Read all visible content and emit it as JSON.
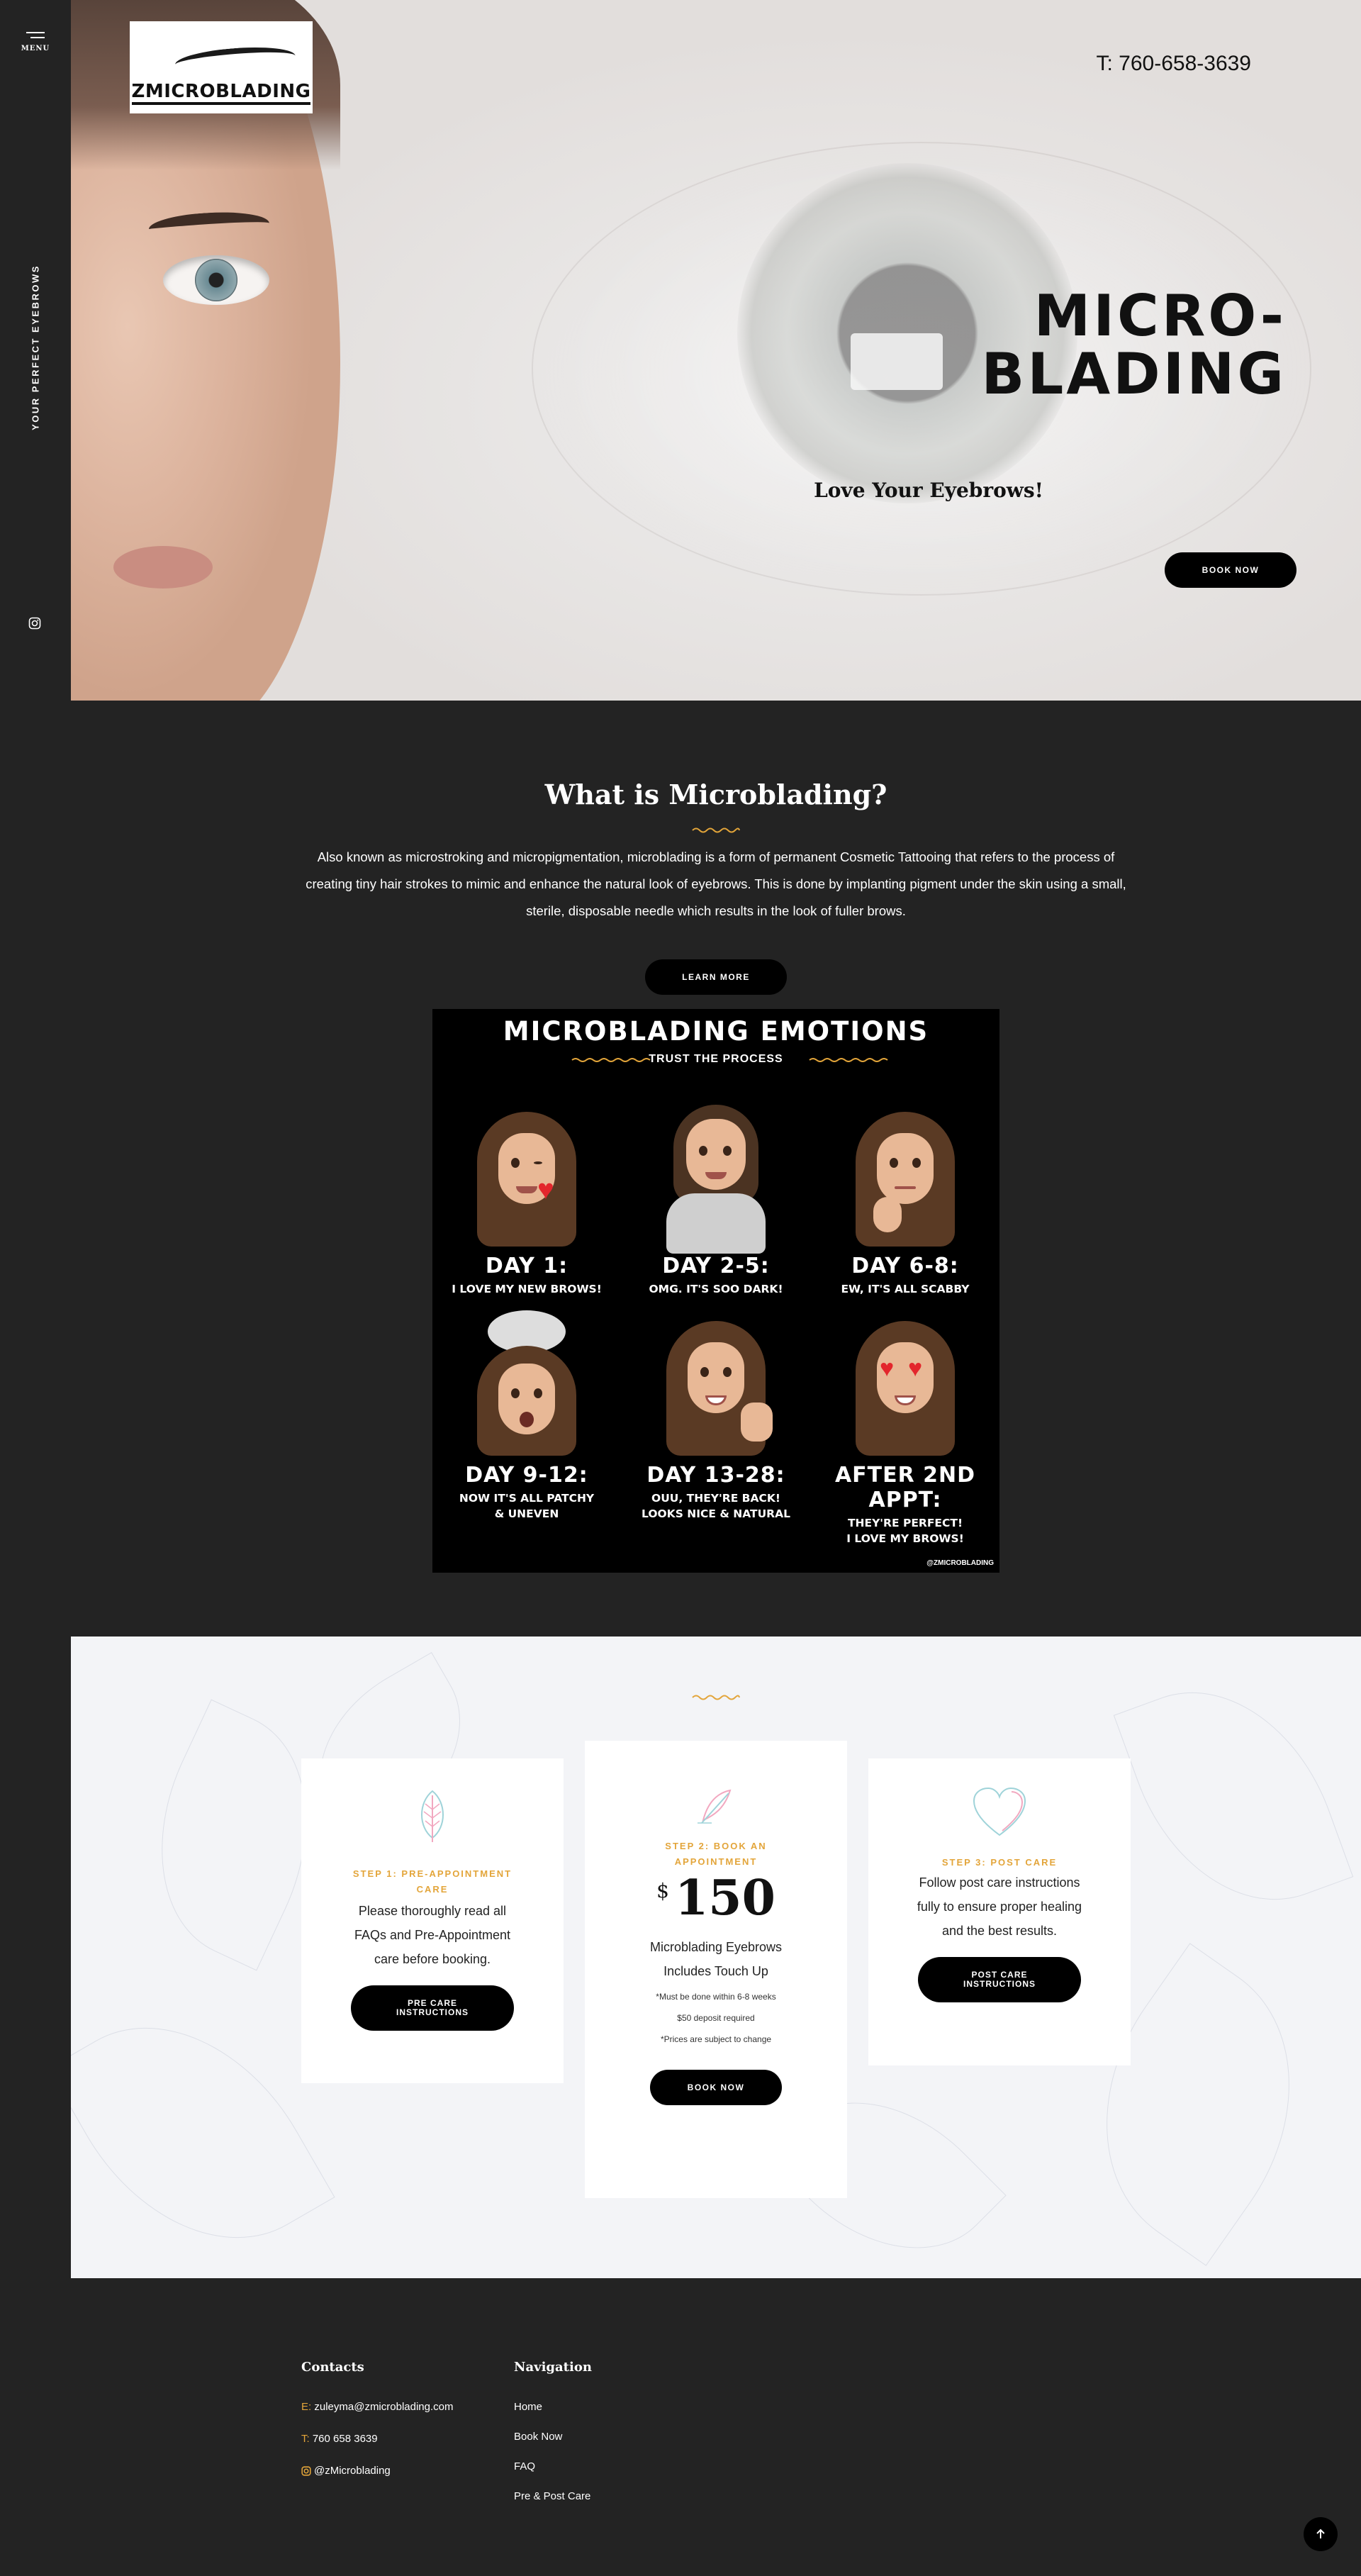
{
  "sidebar": {
    "menu_label": "MENU",
    "tagline": "YOUR PERFECT EYEBROWS"
  },
  "header": {
    "logo_text": "ZMICROBLADING",
    "phone": "T: 760-658-3639"
  },
  "hero": {
    "title_line1": "MICRO-",
    "title_line2": "BLADING",
    "subtitle": "Love Your Eyebrows!",
    "cta": "BOOK NOW"
  },
  "about": {
    "title": "What is Microblading?",
    "body": "Also known as microstroking and micropigmentation, microblading is a form of permanent Cosmetic Tattooing that refers to the process of creating tiny hair strokes to mimic and enhance the natural look of eyebrows. This is done by implanting pigment under the skin using a small, sterile, disposable needle which results in the look of fuller brows.",
    "cta": "LEARN MORE"
  },
  "emotions": {
    "title": "MICROBLADING EMOTIONS",
    "subtitle": "TRUST THE PROCESS",
    "handle": "@ZMICROBLADING",
    "cells": [
      {
        "day": "DAY 1:",
        "caption": "I LOVE MY NEW BROWS!"
      },
      {
        "day": "DAY 2-5:",
        "caption": "OMG. IT'S SOO DARK!"
      },
      {
        "day": "DAY 6-8:",
        "caption": "EW, IT'S ALL SCABBY"
      },
      {
        "day": "DAY 9-12:",
        "caption_1": "NOW IT'S ALL PATCHY",
        "caption_2": "& UNEVEN"
      },
      {
        "day": "DAY 13-28:",
        "caption_1": "OUU, THEY'RE BACK!",
        "caption_2": "LOOKS NICE & NATURAL"
      },
      {
        "day": "AFTER 2ND APPT:",
        "caption_1": "THEY'RE PERFECT!",
        "caption_2": "I LOVE MY BROWS!"
      }
    ]
  },
  "steps": {
    "step1": {
      "label_1": "STEP 1: PRE-APPOINTMENT",
      "label_2": "CARE",
      "text_1": "Please thoroughly read all",
      "text_2": "FAQs and Pre-Appointment",
      "text_3": "care before booking.",
      "btn_1": "PRE CARE",
      "btn_2": "INSTRUCTIONS",
      "icon": "leaf-icon"
    },
    "step2": {
      "label_1": "STEP 2: BOOK AN",
      "label_2": "APPOINTMENT",
      "currency": "$",
      "price": "150",
      "service_1": "Microblading Eyebrows",
      "service_2": "Includes Touch Up",
      "note_1": "*Must be done within 6-8 weeks",
      "note_2": "$50 deposit required",
      "note_3": "*Prices are subject to change",
      "btn": "BOOK NOW",
      "icon": "feather-icon"
    },
    "step3": {
      "label": "STEP 3: POST CARE",
      "text_1": "Follow post care instructions",
      "text_2": "fully to ensure proper healing",
      "text_3": "and the best results.",
      "btn_1": "POST CARE",
      "btn_2": "INSTRUCTIONS",
      "icon": "heart-icon"
    }
  },
  "footer": {
    "contacts_title": "Contacts",
    "email_key": "E:",
    "email": "zuleyma@zmicroblading.com",
    "phone_key": "T:",
    "phone": "760 658 3639",
    "instagram": "@zMicroblading",
    "nav_title": "Navigation",
    "nav": [
      "Home",
      "Book Now",
      "FAQ",
      "Pre & Post Care"
    ]
  },
  "colors": {
    "accent": "#e3a53a",
    "dark": "#232323",
    "light_bg": "#f3f4f7"
  }
}
